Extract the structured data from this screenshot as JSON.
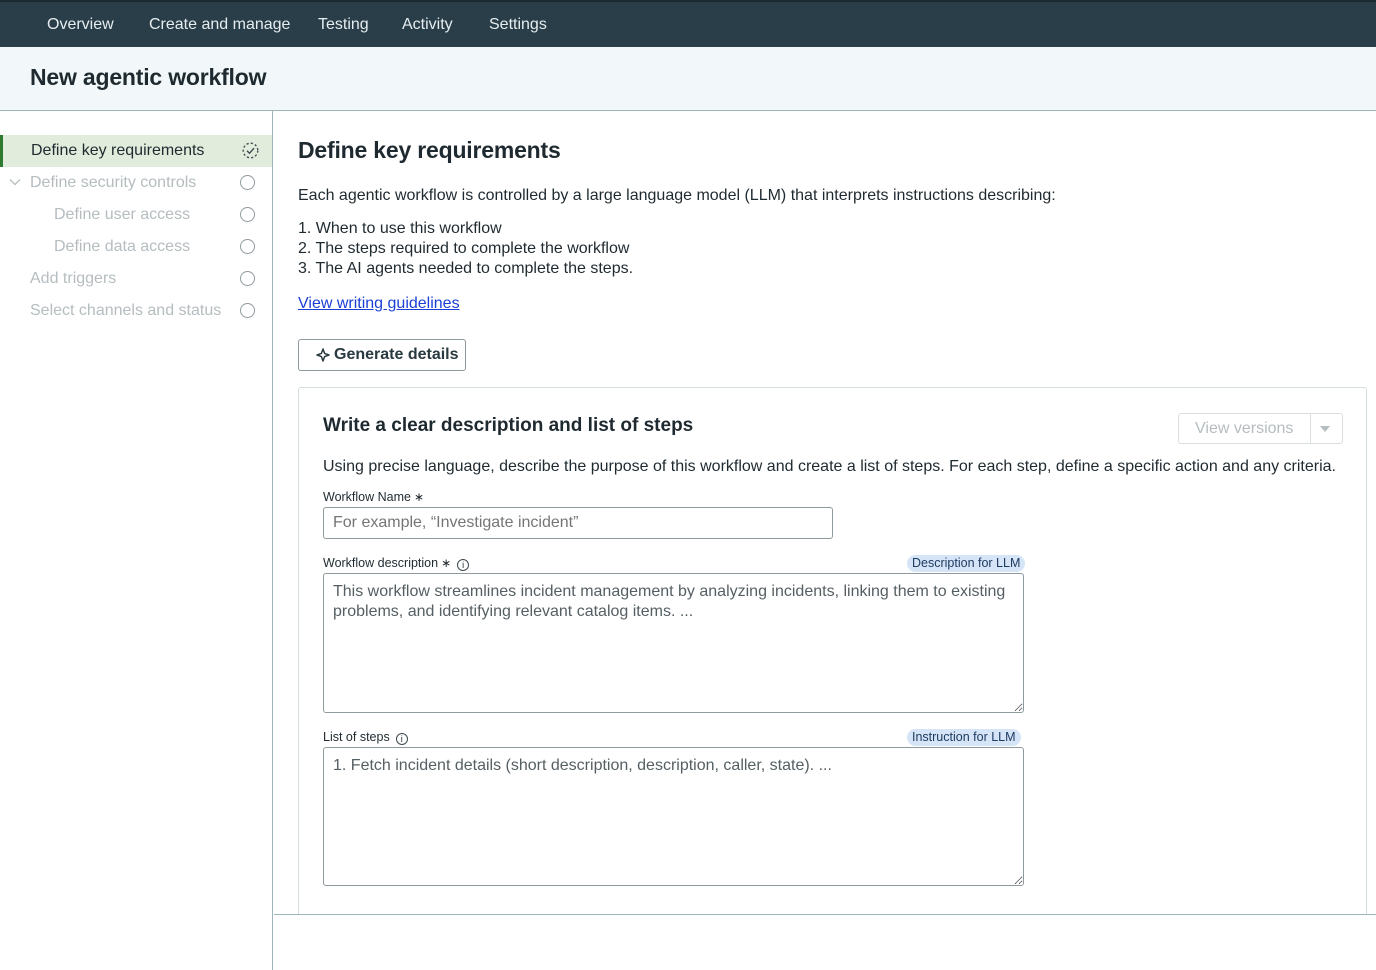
{
  "topnav": {
    "tabs": [
      "Overview",
      "Create and manage",
      "Testing",
      "Activity",
      "Settings"
    ]
  },
  "page": {
    "title": "New agentic workflow"
  },
  "sidebar": {
    "steps": [
      {
        "label": "Define key requirements",
        "state": "in-progress"
      },
      {
        "label": "Define security controls",
        "state": "pending"
      },
      {
        "label": "Define user access",
        "state": "pending"
      },
      {
        "label": "Define data access",
        "state": "pending"
      },
      {
        "label": "Add triggers",
        "state": "pending"
      },
      {
        "label": "Select channels and status",
        "state": "pending"
      }
    ]
  },
  "main": {
    "heading": "Define key requirements",
    "intro": "Each agentic workflow is controlled by a large language model (LLM) that interprets instructions describing:",
    "list": [
      "1. When to use this workflow",
      "2. The steps required to complete the workflow",
      "3. The AI agents needed to complete the steps."
    ],
    "guidelines_link": "View writing guidelines",
    "generate_button": "Generate details"
  },
  "card": {
    "title": "Write a clear description and list of steps",
    "view_versions": "View versions",
    "description": "Using precise language, describe the purpose of this workflow and create a list of steps. For each step, define a specific action and any criteria.",
    "name_field": {
      "label": "Workflow Name",
      "required_mark": "∗",
      "placeholder": "For example, “Investigate incident”"
    },
    "description_field": {
      "label": "Workflow description",
      "required_mark": "∗",
      "badge": "Description for LLM",
      "value": "This workflow streamlines incident management by analyzing incidents, linking them to existing problems, and identifying relevant catalog items. ..."
    },
    "steps_field": {
      "label": "List of steps",
      "badge": "Instruction for LLM",
      "value": "1. Fetch incident details (short description, description, caller, state). ..."
    }
  },
  "colors": {
    "nav_bg": "#293e48",
    "active_step_bg": "#e2ecdc",
    "active_step_accent": "#2e7a31",
    "link": "#1b3fd6",
    "badge_bg": "#d5e4f7"
  },
  "icons": {
    "in_progress": "progress-circle-icon",
    "pending": "empty-circle-icon",
    "expand": "chevron-down-icon",
    "generate": "sparkle-icon",
    "info": "info-icon",
    "dropdown": "caret-down-icon"
  }
}
